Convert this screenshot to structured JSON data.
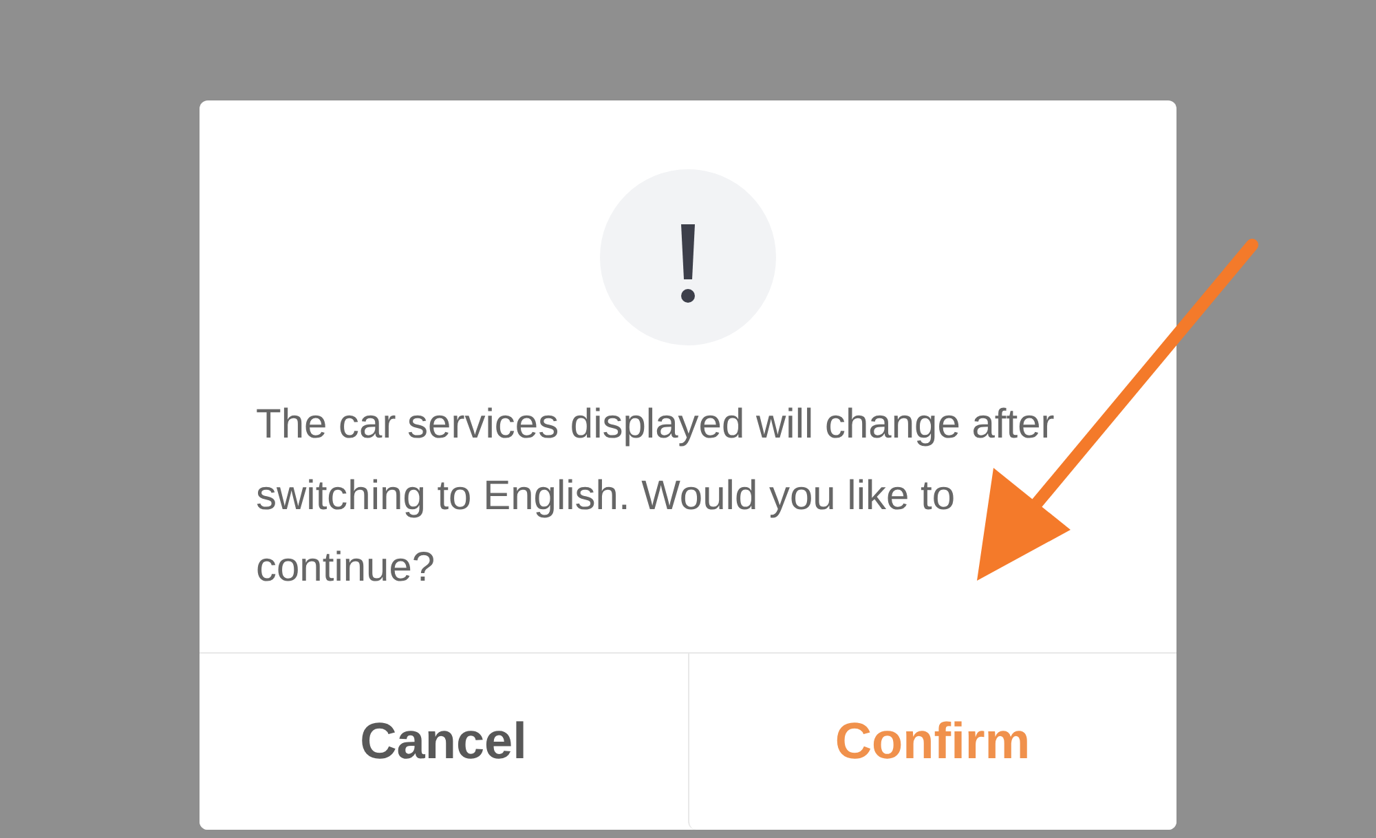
{
  "dialog": {
    "message": "The car services displayed will change after switching to English. Would you like to continue?",
    "buttons": [
      {
        "label": "Cancel",
        "kind": "secondary"
      },
      {
        "label": "Confirm",
        "kind": "primary"
      }
    ]
  },
  "annotation": {
    "kind": "arrow",
    "color": "#f47a2a"
  }
}
